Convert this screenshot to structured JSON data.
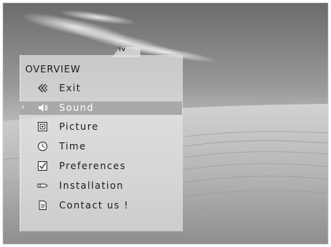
{
  "tab": {
    "label": "TV"
  },
  "menu": {
    "title": "OVERVIEW",
    "items": [
      {
        "label": "Exit",
        "icon": "back-arrows-icon"
      },
      {
        "label": "Sound",
        "icon": "speaker-icon",
        "selected": true
      },
      {
        "label": "Picture",
        "icon": "picture-icon"
      },
      {
        "label": "Time",
        "icon": "clock-icon"
      },
      {
        "label": "Preferences",
        "icon": "checkbox-icon"
      },
      {
        "label": "Installation",
        "icon": "installation-icon"
      },
      {
        "label": "Contact us !",
        "icon": "document-icon"
      }
    ]
  },
  "selector": {
    "glyph": "›"
  }
}
